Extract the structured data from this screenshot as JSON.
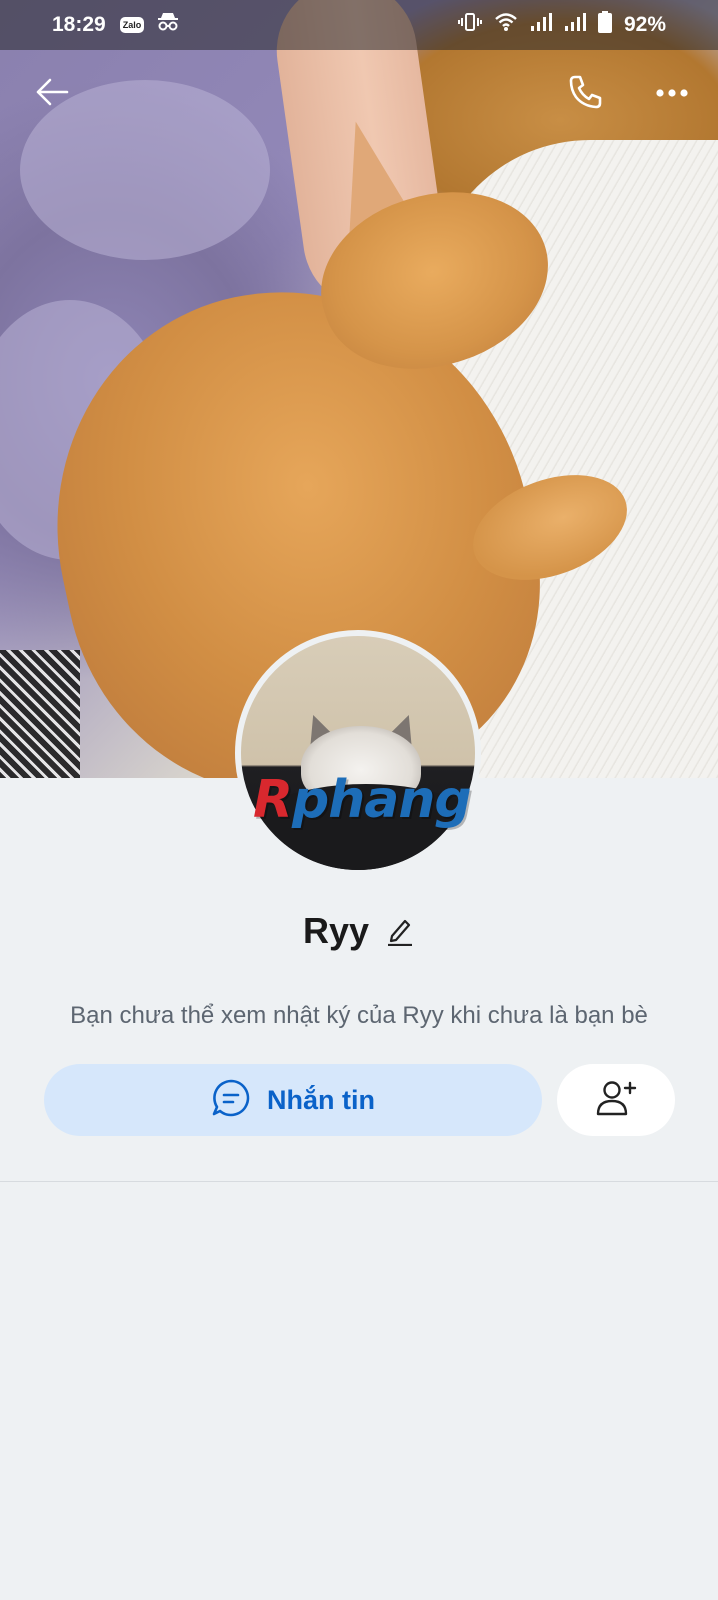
{
  "status_bar": {
    "time": "18:29",
    "app_badge": "Zalo",
    "battery": "92%"
  },
  "profile": {
    "name": "Ryy",
    "info_text": "Bạn chưa thể xem nhật ký của Ryy khi chưa là bạn bè"
  },
  "actions": {
    "message_label": "Nhắn tin"
  },
  "watermark": {
    "first_letter": "R",
    "rest": "phang"
  },
  "colors": {
    "accent": "#0a62c9",
    "message_button_bg": "#d6e7fb",
    "page_bg": "#eef1f3",
    "watermark_red": "#d8282e",
    "watermark_blue": "#1d6db8"
  },
  "icons": {
    "back": "arrow-left-icon",
    "call": "phone-icon",
    "more": "more-horizontal-icon",
    "edit": "pencil-icon",
    "message": "chat-bubble-icon",
    "add_friend": "add-user-icon"
  }
}
